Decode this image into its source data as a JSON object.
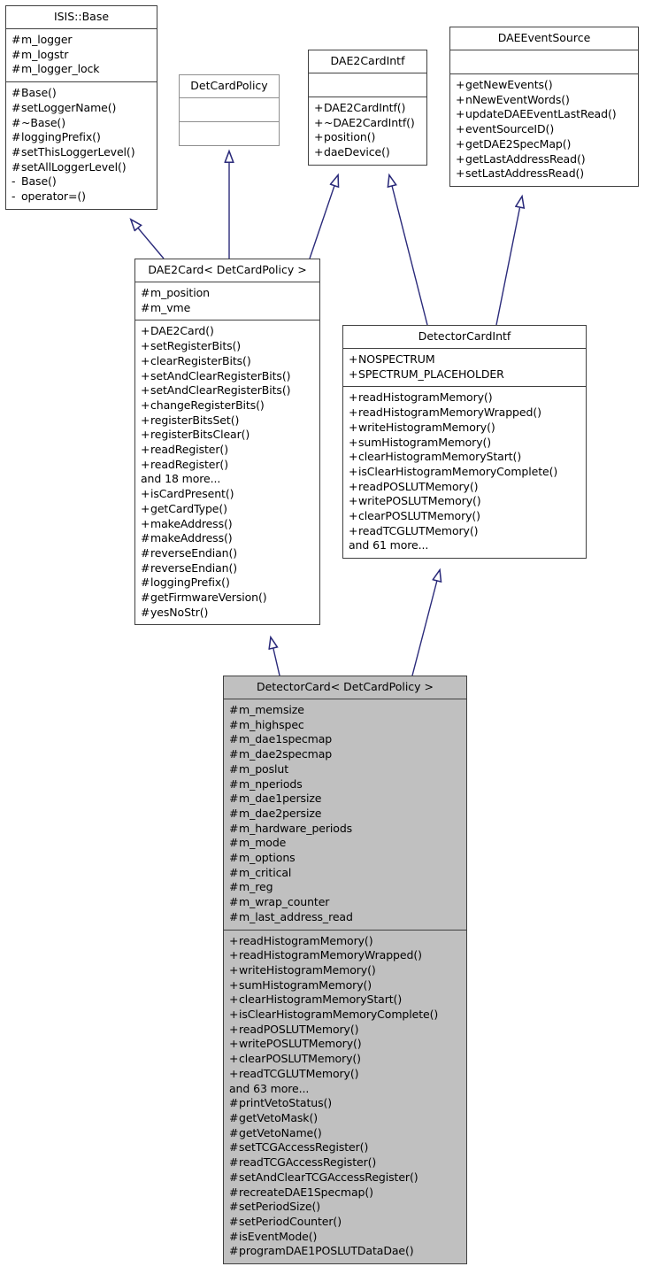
{
  "diagram": {
    "kind": "uml-class-inheritance-diagram",
    "relation_type": "generalization",
    "arrow_color": "#2a2a7a",
    "box_border_color": "#404040",
    "policy_box_border_color": "#8f8f8f",
    "highlight_fill": "#c0c0c0",
    "background": "#ffffff"
  },
  "classes": {
    "isis_base": {
      "name": "ISIS::Base",
      "attributes": [
        {
          "vis": "#",
          "label": "m_logger"
        },
        {
          "vis": "#",
          "label": "m_logstr"
        },
        {
          "vis": "#",
          "label": "m_logger_lock"
        }
      ],
      "operations": [
        {
          "vis": "#",
          "label": "Base()"
        },
        {
          "vis": "#",
          "label": "setLoggerName()"
        },
        {
          "vis": "#",
          "label": "~Base()"
        },
        {
          "vis": "#",
          "label": "loggingPrefix()"
        },
        {
          "vis": "#",
          "label": "setThisLoggerLevel()"
        },
        {
          "vis": "#",
          "label": "setAllLoggerLevel()"
        },
        {
          "vis": "-",
          "label": "Base()"
        },
        {
          "vis": "-",
          "label": "operator=()"
        }
      ]
    },
    "det_card_policy": {
      "name": "DetCardPolicy",
      "attributes": [],
      "operations": []
    },
    "dae2_card_intf": {
      "name": "DAE2CardIntf",
      "attributes": [],
      "operations": [
        {
          "vis": "+",
          "label": "DAE2CardIntf()"
        },
        {
          "vis": "+",
          "label": "~DAE2CardIntf()"
        },
        {
          "vis": "+",
          "label": "position()"
        },
        {
          "vis": "+",
          "label": "daeDevice()"
        }
      ]
    },
    "dae_event_source": {
      "name": "DAEEventSource",
      "attributes": [],
      "operations": [
        {
          "vis": "+",
          "label": "getNewEvents()"
        },
        {
          "vis": "+",
          "label": "nNewEventWords()"
        },
        {
          "vis": "+",
          "label": "updateDAEEventLastRead()"
        },
        {
          "vis": "+",
          "label": "eventSourceID()"
        },
        {
          "vis": "+",
          "label": "getDAE2SpecMap()"
        },
        {
          "vis": "+",
          "label": "getLastAddressRead()"
        },
        {
          "vis": "+",
          "label": "setLastAddressRead()"
        }
      ]
    },
    "dae2_card": {
      "name": "DAE2Card< DetCardPolicy >",
      "attributes": [
        {
          "vis": "#",
          "label": "m_position"
        },
        {
          "vis": "#",
          "label": "m_vme"
        }
      ],
      "operations": [
        {
          "vis": "+",
          "label": "DAE2Card()"
        },
        {
          "vis": "+",
          "label": "setRegisterBits()"
        },
        {
          "vis": "+",
          "label": "clearRegisterBits()"
        },
        {
          "vis": "+",
          "label": "setAndClearRegisterBits()"
        },
        {
          "vis": "+",
          "label": "setAndClearRegisterBits()"
        },
        {
          "vis": "+",
          "label": "changeRegisterBits()"
        },
        {
          "vis": "+",
          "label": "registerBitsSet()"
        },
        {
          "vis": "+",
          "label": "registerBitsClear()"
        },
        {
          "vis": "+",
          "label": "readRegister()"
        },
        {
          "vis": "+",
          "label": "readRegister()"
        },
        {
          "vis": "",
          "label": "and 18 more..."
        },
        {
          "vis": "+",
          "label": "isCardPresent()"
        },
        {
          "vis": "+",
          "label": "getCardType()"
        },
        {
          "vis": "+",
          "label": "makeAddress()"
        },
        {
          "vis": "#",
          "label": "makeAddress()"
        },
        {
          "vis": "#",
          "label": "reverseEndian()"
        },
        {
          "vis": "#",
          "label": "reverseEndian()"
        },
        {
          "vis": "#",
          "label": "loggingPrefix()"
        },
        {
          "vis": "#",
          "label": "getFirmwareVersion()"
        },
        {
          "vis": "#",
          "label": "yesNoStr()"
        }
      ]
    },
    "detector_card_intf": {
      "name": "DetectorCardIntf",
      "attributes": [
        {
          "vis": "+",
          "label": "NOSPECTRUM"
        },
        {
          "vis": "+",
          "label": "SPECTRUM_PLACEHOLDER"
        }
      ],
      "operations": [
        {
          "vis": "+",
          "label": "readHistogramMemory()"
        },
        {
          "vis": "+",
          "label": "readHistogramMemoryWrapped()"
        },
        {
          "vis": "+",
          "label": "writeHistogramMemory()"
        },
        {
          "vis": "+",
          "label": "sumHistogramMemory()"
        },
        {
          "vis": "+",
          "label": "clearHistogramMemoryStart()"
        },
        {
          "vis": "+",
          "label": "isClearHistogramMemoryComplete()"
        },
        {
          "vis": "+",
          "label": "readPOSLUTMemory()"
        },
        {
          "vis": "+",
          "label": "writePOSLUTMemory()"
        },
        {
          "vis": "+",
          "label": "clearPOSLUTMemory()"
        },
        {
          "vis": "+",
          "label": "readTCGLUTMemory()"
        },
        {
          "vis": "",
          "label": "and 61 more..."
        }
      ]
    },
    "detector_card": {
      "name": "DetectorCard< DetCardPolicy >",
      "attributes": [
        {
          "vis": "#",
          "label": "m_memsize"
        },
        {
          "vis": "#",
          "label": "m_highspec"
        },
        {
          "vis": "#",
          "label": "m_dae1specmap"
        },
        {
          "vis": "#",
          "label": "m_dae2specmap"
        },
        {
          "vis": "#",
          "label": "m_poslut"
        },
        {
          "vis": "#",
          "label": "m_nperiods"
        },
        {
          "vis": "#",
          "label": "m_dae1persize"
        },
        {
          "vis": "#",
          "label": "m_dae2persize"
        },
        {
          "vis": "#",
          "label": "m_hardware_periods"
        },
        {
          "vis": "#",
          "label": "m_mode"
        },
        {
          "vis": "#",
          "label": "m_options"
        },
        {
          "vis": "#",
          "label": "m_critical"
        },
        {
          "vis": "#",
          "label": "m_reg"
        },
        {
          "vis": "#",
          "label": "m_wrap_counter"
        },
        {
          "vis": "#",
          "label": "m_last_address_read"
        }
      ],
      "operations": [
        {
          "vis": "+",
          "label": "readHistogramMemory()"
        },
        {
          "vis": "+",
          "label": "readHistogramMemoryWrapped()"
        },
        {
          "vis": "+",
          "label": "writeHistogramMemory()"
        },
        {
          "vis": "+",
          "label": "sumHistogramMemory()"
        },
        {
          "vis": "+",
          "label": "clearHistogramMemoryStart()"
        },
        {
          "vis": "+",
          "label": "isClearHistogramMemoryComplete()"
        },
        {
          "vis": "+",
          "label": "readPOSLUTMemory()"
        },
        {
          "vis": "+",
          "label": "writePOSLUTMemory()"
        },
        {
          "vis": "+",
          "label": "clearPOSLUTMemory()"
        },
        {
          "vis": "+",
          "label": "readTCGLUTMemory()"
        },
        {
          "vis": "",
          "label": "and 63 more..."
        },
        {
          "vis": "#",
          "label": "printVetoStatus()"
        },
        {
          "vis": "#",
          "label": "getVetoMask()"
        },
        {
          "vis": "#",
          "label": "getVetoName()"
        },
        {
          "vis": "#",
          "label": "setTCGAccessRegister()"
        },
        {
          "vis": "#",
          "label": "readTCGAccessRegister()"
        },
        {
          "vis": "#",
          "label": "setAndClearTCGAccessRegister()"
        },
        {
          "vis": "#",
          "label": "recreateDAE1Specmap()"
        },
        {
          "vis": "#",
          "label": "setPeriodSize()"
        },
        {
          "vis": "#",
          "label": "setPeriodCounter()"
        },
        {
          "vis": "#",
          "label": "isEventMode()"
        },
        {
          "vis": "#",
          "label": "programDAE1POSLUTDataDae()"
        }
      ]
    }
  },
  "edges": [
    {
      "from": "dae2_card",
      "to": "isis_base",
      "kind": "inheritance"
    },
    {
      "from": "dae2_card",
      "to": "det_card_policy",
      "kind": "inheritance"
    },
    {
      "from": "dae2_card",
      "to": "dae2_card_intf",
      "kind": "inheritance"
    },
    {
      "from": "detector_card_intf",
      "to": "dae2_card_intf",
      "kind": "inheritance"
    },
    {
      "from": "detector_card_intf",
      "to": "dae_event_source",
      "kind": "inheritance"
    },
    {
      "from": "detector_card",
      "to": "dae2_card",
      "kind": "inheritance"
    },
    {
      "from": "detector_card",
      "to": "detector_card_intf",
      "kind": "inheritance"
    }
  ]
}
